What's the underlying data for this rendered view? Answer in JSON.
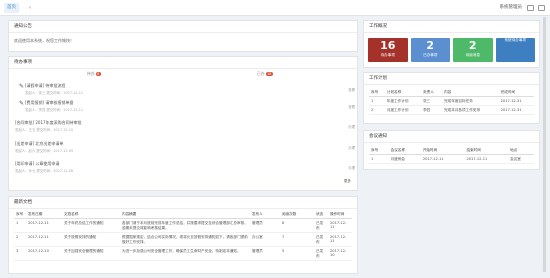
{
  "topbar": {
    "tab_label": "首页",
    "chevron": "‹",
    "user_label": "系统管理员"
  },
  "notice": {
    "title": "通知公告",
    "text": "欢迎使用本系统，祝您工作愉快！"
  },
  "tasks": {
    "title": "待办事项",
    "tab_todo": {
      "label": "待办",
      "count": "6"
    },
    "tab_done": {
      "label": "已办",
      "count": "18"
    },
    "items": [
      {
        "title": "[请假申请] 待审批流程",
        "sub": "发起人：张三  提交时间：2017-12-11",
        "right": "查看"
      },
      {
        "title": "[费用报销] 请审核报销单据",
        "sub": "发起人：李四  提交时间：2017-12-11",
        "right": "查看"
      },
      {
        "title": "[合同审批] 2017年度采购合同待审批",
        "sub": "发起人：王五  提交时间：2017-12-10",
        "right": "办理"
      },
      {
        "title": "[出差申请] 北京出差申请单",
        "sub": "发起人：赵六  提交时间：2017-12-09",
        "right": "办理"
      },
      {
        "title": "[用印申请] 公章使用申请",
        "sub": "发起人：孙七  提交时间：2017-12-08",
        "right": "办理"
      }
    ],
    "more": "更多"
  },
  "docs": {
    "title": "最新文档",
    "headers": [
      "序号",
      "发布日期",
      "文档名称",
      "内容摘要",
      "发布人",
      "阅读次数",
      "状态",
      "操作时间"
    ],
    "rows": [
      [
        "1",
        "2017-12-11",
        "关于年终总结工作的通知",
        "各部门请于本月底前完成年度工作总结，并按要求提交至综合管理部汇总审核，逾期未提交将影响考核结果。",
        "管理员",
        "6",
        "已发布",
        "2017-12-11"
      ],
      [
        "2",
        "2017-12-11",
        "关于放假安排的通知",
        "根据国家规定，结合公司实际情况，现将元旦放假安排通知如下，请各部门提前做好工作安排。",
        "办公室",
        "7",
        "已发布",
        "2017-12-11"
      ],
      [
        "3",
        "2017-12-10",
        "关于加强安全管理的通知",
        "为进一步加强公司安全管理工作，确保员工生命财产安全，特制定本通知。",
        "管理员",
        "5",
        "已发布",
        "2017-12-10"
      ]
    ]
  },
  "overview": {
    "title": "工作概况",
    "cards": [
      {
        "number": "16",
        "label": "待办事项",
        "color": "#a4322a"
      },
      {
        "number": "2",
        "label": "已办事项",
        "color": "#5b8fcf"
      },
      {
        "number": "2",
        "label": "待阅消息",
        "color": "#4fb96a"
      },
      {
        "number": "",
        "label": "系统待办事项",
        "color": "#3e7fc1"
      }
    ]
  },
  "plans": {
    "title": "工作计划",
    "headers": [
      "序号",
      "计划名称",
      "负责人",
      "内容",
      "完成时间"
    ],
    "rows": [
      [
        "1",
        "年度工作计划",
        "张三",
        "完成年度目标任务",
        "2017-12-31"
      ],
      [
        "2",
        "月度工作计划",
        "李四",
        "完成本月各项工作安排",
        "2017-12-31"
      ]
    ]
  },
  "meetings": {
    "title": "会议通知",
    "headers": [
      "序号",
      "会议名称",
      "开始时间",
      "结束时间",
      "地点"
    ],
    "rows": [
      [
        "1",
        "月度例会",
        "2017-12-11",
        "2017-12-11",
        "会议室"
      ]
    ]
  }
}
